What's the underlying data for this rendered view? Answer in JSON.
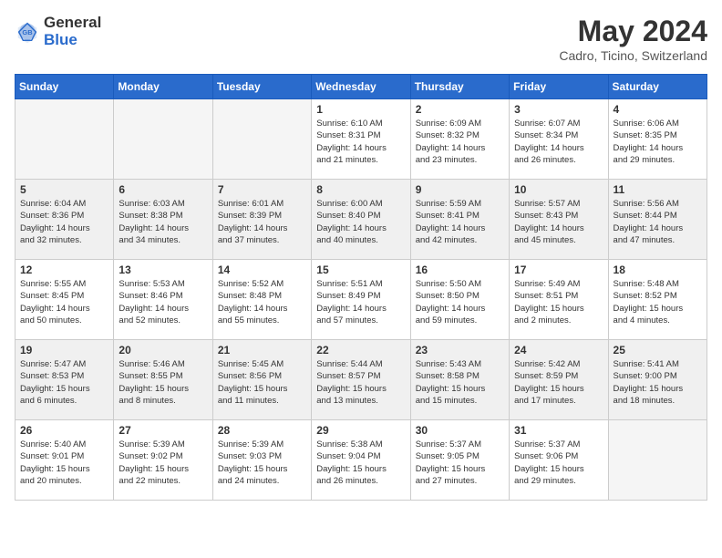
{
  "logo": {
    "general": "General",
    "blue": "Blue"
  },
  "title": "May 2024",
  "subtitle": "Cadro, Ticino, Switzerland",
  "days_of_week": [
    "Sunday",
    "Monday",
    "Tuesday",
    "Wednesday",
    "Thursday",
    "Friday",
    "Saturday"
  ],
  "weeks": [
    {
      "row_shade": false,
      "days": [
        {
          "number": "",
          "info": "",
          "empty": true
        },
        {
          "number": "",
          "info": "",
          "empty": true
        },
        {
          "number": "",
          "info": "",
          "empty": true
        },
        {
          "number": "1",
          "info": "Sunrise: 6:10 AM\nSunset: 8:31 PM\nDaylight: 14 hours\nand 21 minutes.",
          "empty": false
        },
        {
          "number": "2",
          "info": "Sunrise: 6:09 AM\nSunset: 8:32 PM\nDaylight: 14 hours\nand 23 minutes.",
          "empty": false
        },
        {
          "number": "3",
          "info": "Sunrise: 6:07 AM\nSunset: 8:34 PM\nDaylight: 14 hours\nand 26 minutes.",
          "empty": false
        },
        {
          "number": "4",
          "info": "Sunrise: 6:06 AM\nSunset: 8:35 PM\nDaylight: 14 hours\nand 29 minutes.",
          "empty": false
        }
      ]
    },
    {
      "row_shade": true,
      "days": [
        {
          "number": "5",
          "info": "Sunrise: 6:04 AM\nSunset: 8:36 PM\nDaylight: 14 hours\nand 32 minutes.",
          "empty": false
        },
        {
          "number": "6",
          "info": "Sunrise: 6:03 AM\nSunset: 8:38 PM\nDaylight: 14 hours\nand 34 minutes.",
          "empty": false
        },
        {
          "number": "7",
          "info": "Sunrise: 6:01 AM\nSunset: 8:39 PM\nDaylight: 14 hours\nand 37 minutes.",
          "empty": false
        },
        {
          "number": "8",
          "info": "Sunrise: 6:00 AM\nSunset: 8:40 PM\nDaylight: 14 hours\nand 40 minutes.",
          "empty": false
        },
        {
          "number": "9",
          "info": "Sunrise: 5:59 AM\nSunset: 8:41 PM\nDaylight: 14 hours\nand 42 minutes.",
          "empty": false
        },
        {
          "number": "10",
          "info": "Sunrise: 5:57 AM\nSunset: 8:43 PM\nDaylight: 14 hours\nand 45 minutes.",
          "empty": false
        },
        {
          "number": "11",
          "info": "Sunrise: 5:56 AM\nSunset: 8:44 PM\nDaylight: 14 hours\nand 47 minutes.",
          "empty": false
        }
      ]
    },
    {
      "row_shade": false,
      "days": [
        {
          "number": "12",
          "info": "Sunrise: 5:55 AM\nSunset: 8:45 PM\nDaylight: 14 hours\nand 50 minutes.",
          "empty": false
        },
        {
          "number": "13",
          "info": "Sunrise: 5:53 AM\nSunset: 8:46 PM\nDaylight: 14 hours\nand 52 minutes.",
          "empty": false
        },
        {
          "number": "14",
          "info": "Sunrise: 5:52 AM\nSunset: 8:48 PM\nDaylight: 14 hours\nand 55 minutes.",
          "empty": false
        },
        {
          "number": "15",
          "info": "Sunrise: 5:51 AM\nSunset: 8:49 PM\nDaylight: 14 hours\nand 57 minutes.",
          "empty": false
        },
        {
          "number": "16",
          "info": "Sunrise: 5:50 AM\nSunset: 8:50 PM\nDaylight: 14 hours\nand 59 minutes.",
          "empty": false
        },
        {
          "number": "17",
          "info": "Sunrise: 5:49 AM\nSunset: 8:51 PM\nDaylight: 15 hours\nand 2 minutes.",
          "empty": false
        },
        {
          "number": "18",
          "info": "Sunrise: 5:48 AM\nSunset: 8:52 PM\nDaylight: 15 hours\nand 4 minutes.",
          "empty": false
        }
      ]
    },
    {
      "row_shade": true,
      "days": [
        {
          "number": "19",
          "info": "Sunrise: 5:47 AM\nSunset: 8:53 PM\nDaylight: 15 hours\nand 6 minutes.",
          "empty": false
        },
        {
          "number": "20",
          "info": "Sunrise: 5:46 AM\nSunset: 8:55 PM\nDaylight: 15 hours\nand 8 minutes.",
          "empty": false
        },
        {
          "number": "21",
          "info": "Sunrise: 5:45 AM\nSunset: 8:56 PM\nDaylight: 15 hours\nand 11 minutes.",
          "empty": false
        },
        {
          "number": "22",
          "info": "Sunrise: 5:44 AM\nSunset: 8:57 PM\nDaylight: 15 hours\nand 13 minutes.",
          "empty": false
        },
        {
          "number": "23",
          "info": "Sunrise: 5:43 AM\nSunset: 8:58 PM\nDaylight: 15 hours\nand 15 minutes.",
          "empty": false
        },
        {
          "number": "24",
          "info": "Sunrise: 5:42 AM\nSunset: 8:59 PM\nDaylight: 15 hours\nand 17 minutes.",
          "empty": false
        },
        {
          "number": "25",
          "info": "Sunrise: 5:41 AM\nSunset: 9:00 PM\nDaylight: 15 hours\nand 18 minutes.",
          "empty": false
        }
      ]
    },
    {
      "row_shade": false,
      "days": [
        {
          "number": "26",
          "info": "Sunrise: 5:40 AM\nSunset: 9:01 PM\nDaylight: 15 hours\nand 20 minutes.",
          "empty": false
        },
        {
          "number": "27",
          "info": "Sunrise: 5:39 AM\nSunset: 9:02 PM\nDaylight: 15 hours\nand 22 minutes.",
          "empty": false
        },
        {
          "number": "28",
          "info": "Sunrise: 5:39 AM\nSunset: 9:03 PM\nDaylight: 15 hours\nand 24 minutes.",
          "empty": false
        },
        {
          "number": "29",
          "info": "Sunrise: 5:38 AM\nSunset: 9:04 PM\nDaylight: 15 hours\nand 26 minutes.",
          "empty": false
        },
        {
          "number": "30",
          "info": "Sunrise: 5:37 AM\nSunset: 9:05 PM\nDaylight: 15 hours\nand 27 minutes.",
          "empty": false
        },
        {
          "number": "31",
          "info": "Sunrise: 5:37 AM\nSunset: 9:06 PM\nDaylight: 15 hours\nand 29 minutes.",
          "empty": false
        },
        {
          "number": "",
          "info": "",
          "empty": true
        }
      ]
    }
  ]
}
